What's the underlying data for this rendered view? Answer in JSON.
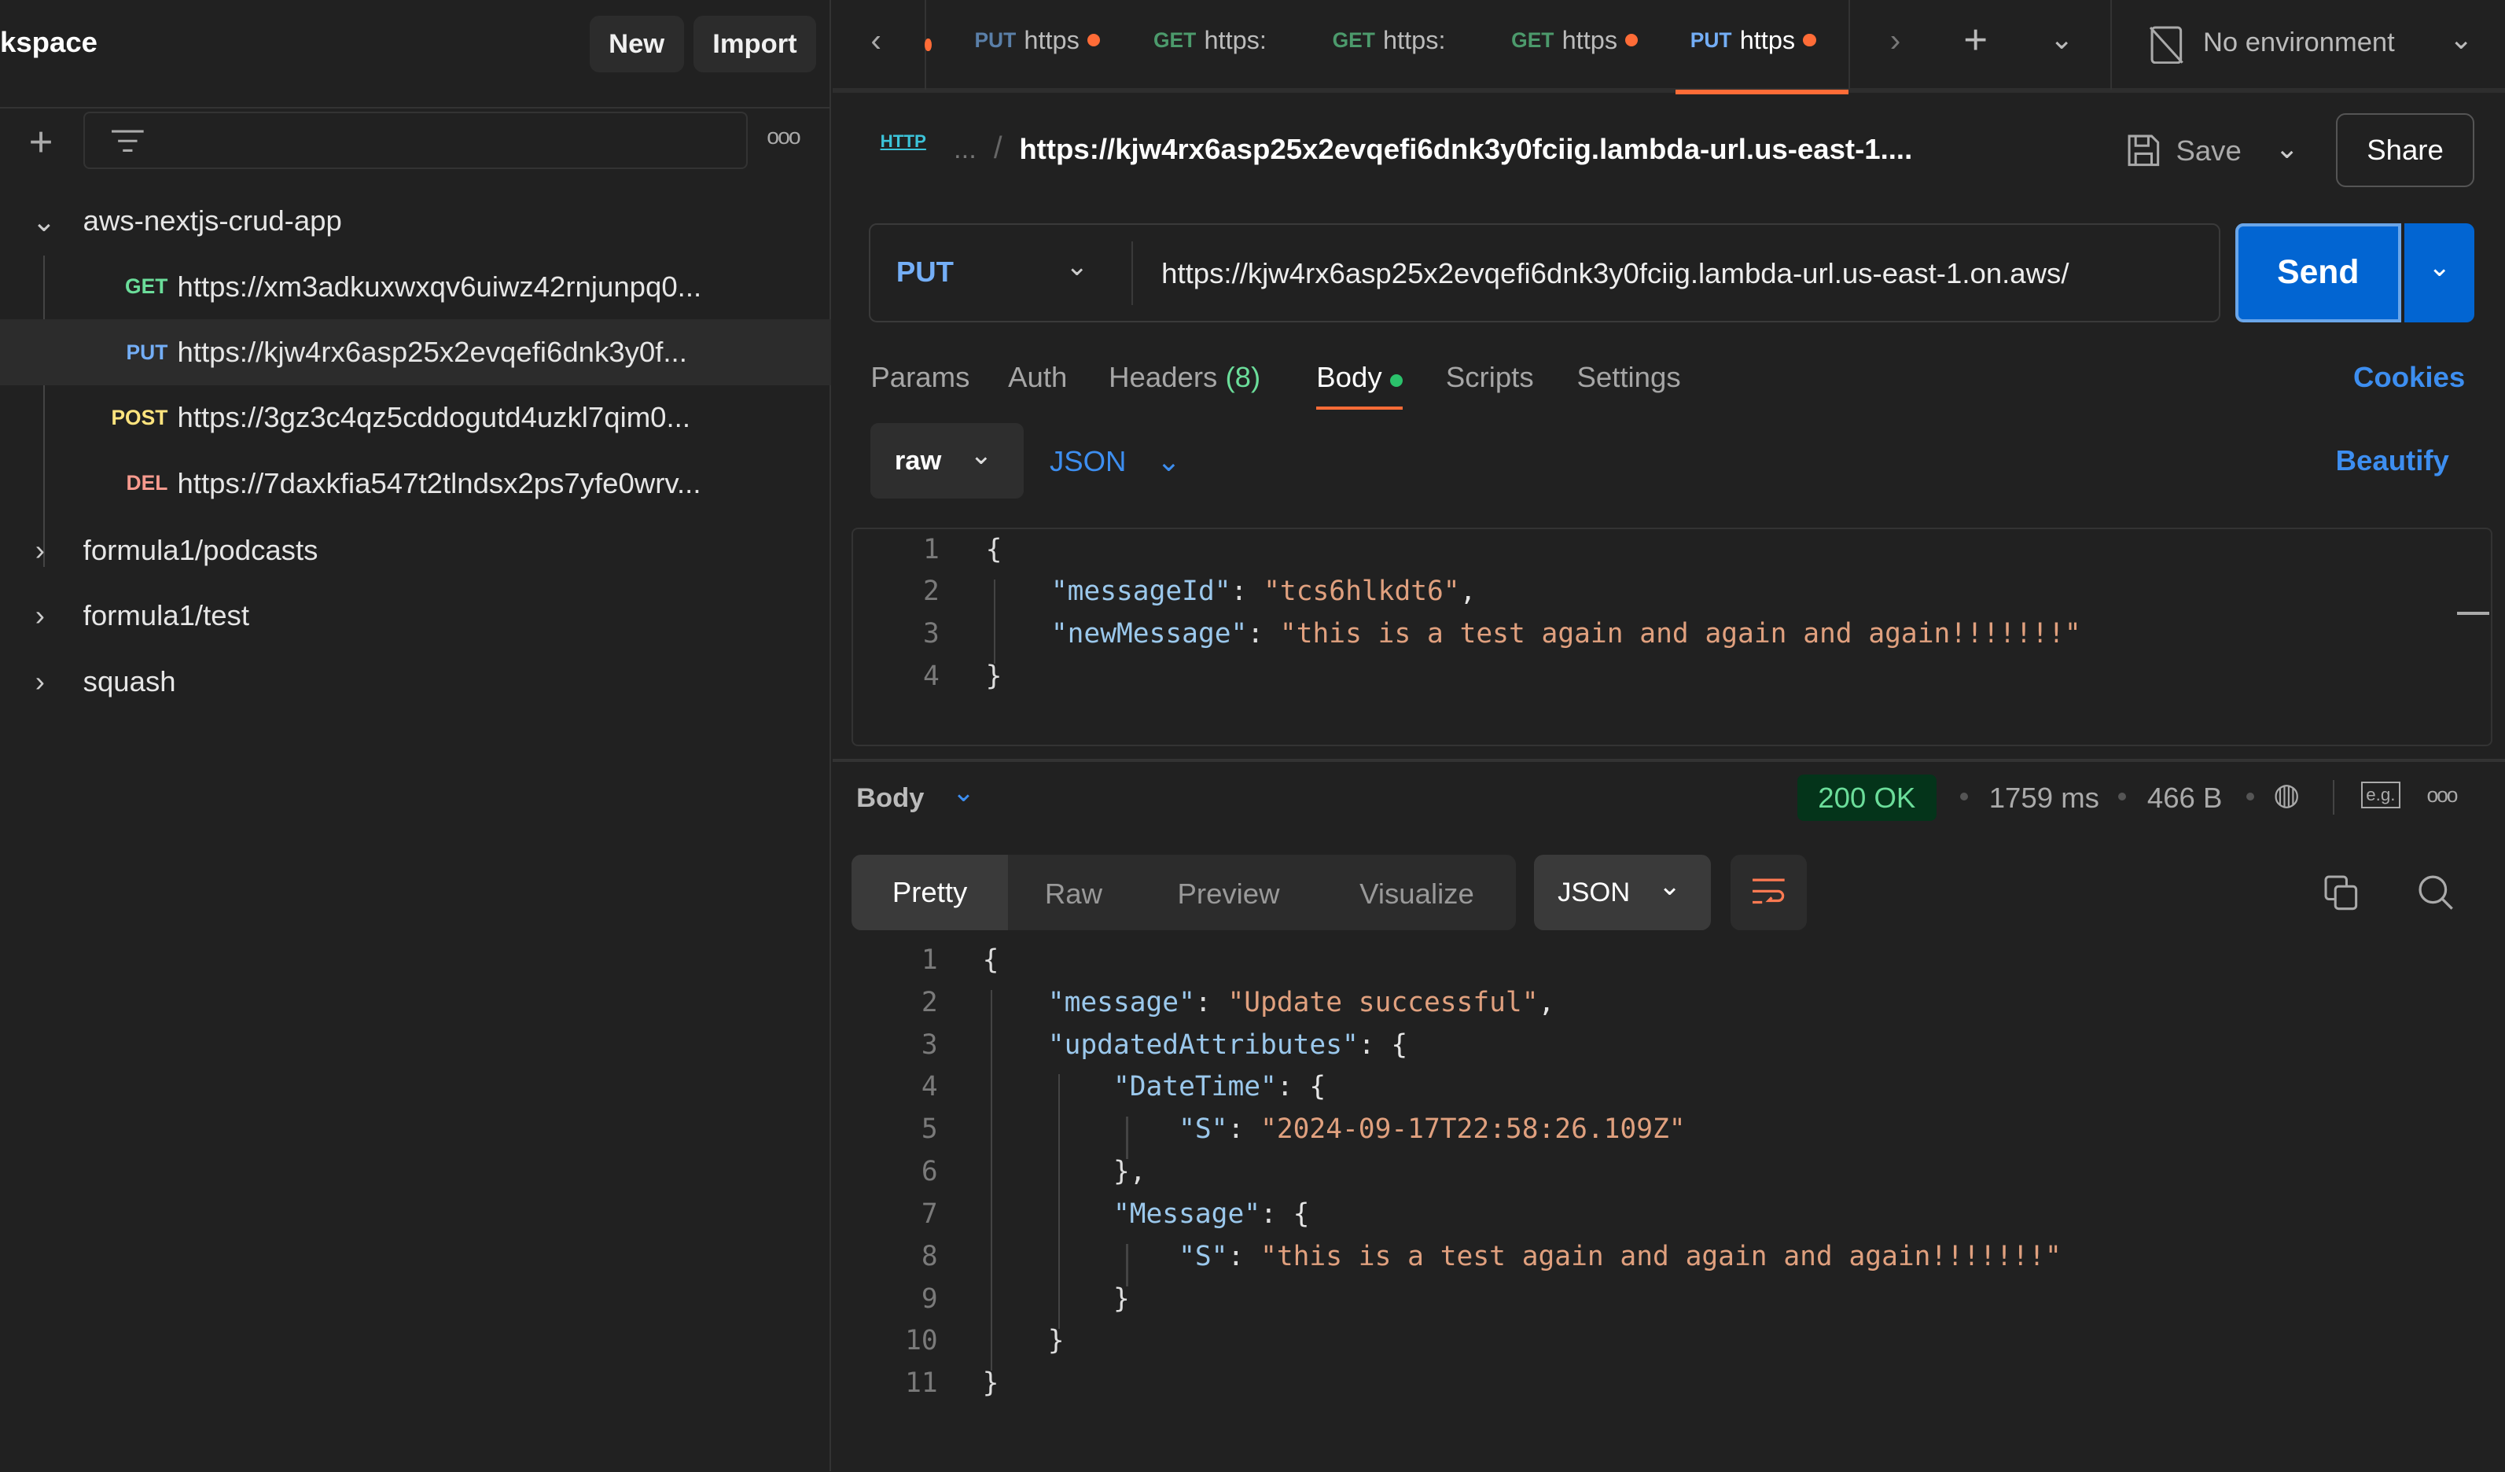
{
  "sidebar": {
    "workspace_title": "kspace",
    "new_label": "New",
    "import_label": "Import",
    "collections": [
      {
        "name": "aws-nextjs-crud-app",
        "expanded": true,
        "requests": [
          {
            "method": "GET",
            "url": "https://xm3adkuxwxqv6uiwz42rnjunpq0...",
            "color": "#6bdd9a"
          },
          {
            "method": "PUT",
            "url": "https://kjw4rx6asp25x2evqefi6dnk3y0f...",
            "color": "#74aef6"
          },
          {
            "method": "POST",
            "url": "https://3gz3c4qz5cddogutd4uzkl7qim0...",
            "color": "#ffe47e"
          },
          {
            "method": "DEL",
            "url": "https://7daxkfia547t2tlndsx2ps7yfe0wrv...",
            "color": "#f79a8e"
          }
        ]
      },
      {
        "name": "formula1/podcasts",
        "expanded": false
      },
      {
        "name": "formula1/test",
        "expanded": false
      },
      {
        "name": "squash",
        "expanded": false
      }
    ]
  },
  "tabs": [
    {
      "method": "PUT",
      "label": "https",
      "unsaved": true,
      "color": "#5a7fa8"
    },
    {
      "method": "GET",
      "label": "https:",
      "unsaved": false,
      "color": "#4c9a6c"
    },
    {
      "method": "GET",
      "label": "https:",
      "unsaved": false,
      "color": "#4c9a6c"
    },
    {
      "method": "GET",
      "label": "https",
      "unsaved": true,
      "color": "#4c9a6c"
    },
    {
      "method": "PUT",
      "label": "https",
      "unsaved": true,
      "color": "#74aef6",
      "active": true
    }
  ],
  "environment": "No environment",
  "request": {
    "breadcrumb_ellipsis": "...",
    "title": "https://kjw4rx6asp25x2evqefi6dnk3y0fciig.lambda-url.us-east-1....",
    "save_label": "Save",
    "share_label": "Share",
    "method": "PUT",
    "url": "https://kjw4rx6asp25x2evqefi6dnk3y0fciig.lambda-url.us-east-1.on.aws/",
    "send_label": "Send",
    "tabs": [
      "Params",
      "Auth",
      "Headers",
      "Body",
      "Scripts",
      "Settings"
    ],
    "headers_count": "(8)",
    "active_tab": "Body",
    "cookies_label": "Cookies",
    "body_mode": "raw",
    "body_format": "JSON",
    "beautify_label": "Beautify",
    "body_lines": [
      "{",
      "    \"messageId\": \"tcs6hlkdt6\",",
      "    \"newMessage\": \"this is a test again and again and again!!!!!!!\"",
      "}"
    ]
  },
  "response": {
    "label": "Body",
    "status": "200 OK",
    "time": "1759 ms",
    "size": "466 B",
    "view_tabs": [
      "Pretty",
      "Raw",
      "Preview",
      "Visualize"
    ],
    "active_view": "Pretty",
    "format": "JSON",
    "lines": [
      "{",
      "    \"message\": \"Update successful\",",
      "    \"updatedAttributes\": {",
      "        \"DateTime\": {",
      "            \"S\": \"2024-09-17T22:58:26.109Z\"",
      "        },",
      "        \"Message\": {",
      "            \"S\": \"this is a test again and again and again!!!!!!!\"",
      "        }",
      "    }",
      "}"
    ]
  },
  "colors": {
    "accent": "#ff6c37",
    "send": "#0265d2",
    "link": "#3d8ef0",
    "status_bg": "#04341a",
    "status_fg": "#6bdd9a"
  }
}
